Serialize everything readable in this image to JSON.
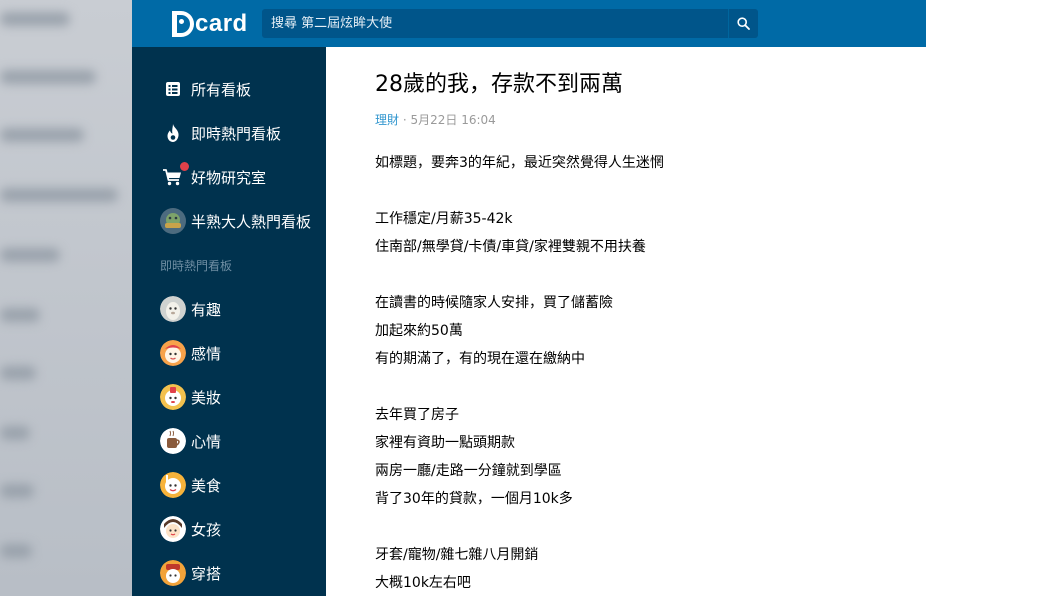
{
  "topbar": {
    "logo_text": "card",
    "search_placeholder": "搜尋 第二屆炫眸大使"
  },
  "sidebar": {
    "main_items": [
      {
        "label": "所有看板",
        "icon": "list-icon"
      },
      {
        "label": "即時熱門看板",
        "icon": "flame-icon"
      },
      {
        "label": "好物研究室",
        "icon": "shopping-cart-icon"
      },
      {
        "label": "半熟大人熱門看板",
        "icon": "globe-avatar-icon"
      }
    ],
    "section_title": "即時熱門看板",
    "boards": [
      {
        "label": "有趣"
      },
      {
        "label": "感情"
      },
      {
        "label": "美妝"
      },
      {
        "label": "心情"
      },
      {
        "label": "美食"
      },
      {
        "label": "女孩"
      },
      {
        "label": "穿搭"
      }
    ]
  },
  "post": {
    "title": "28歲的我，存款不到兩萬",
    "board": "理財",
    "separator": "·",
    "date": "5月22日 16:04",
    "lines": [
      "如標題，要奔3的年紀，最近突然覺得人生迷惘",
      "",
      "工作穩定/月薪35-42k",
      "住南部/無學貸/卡債/車貸/家裡雙親不用扶養",
      "",
      "在讀書的時候隨家人安排，買了儲蓄險",
      "加起來約50萬",
      "有的期滿了，有的現在還在繳納中",
      "",
      "去年買了房子",
      "家裡有資助一點頭期款",
      "兩房一廳/走路一分鐘就到學區",
      "背了30年的貸款，一個月10k多",
      "",
      "牙套/寵物/雜七雜八月開銷",
      "大概10k左右吧"
    ]
  },
  "colors": {
    "topbar": "#006aa6",
    "sidebar": "#00324e",
    "board_link": "#3397cf"
  }
}
